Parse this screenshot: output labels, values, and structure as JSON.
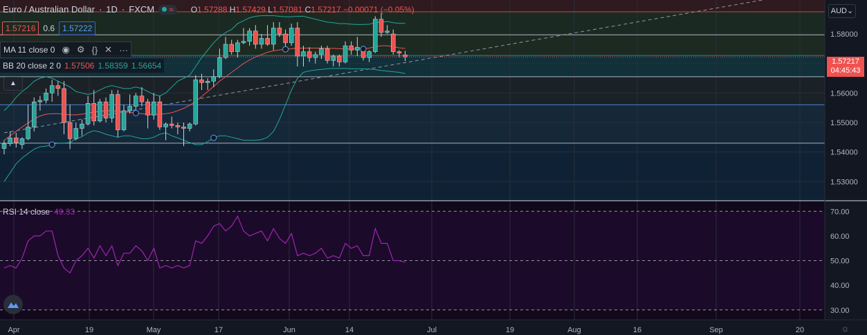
{
  "header": {
    "symbol": "Euro / Australian Dollar",
    "interval": "1D",
    "exchange": "FXCM",
    "open_label": "O",
    "open": "1.57288",
    "high_label": "H",
    "high": "1.57429",
    "low_label": "L",
    "low": "1.57081",
    "close_label": "C",
    "close": "1.57217",
    "change": "−0.00071 (−0.05%)"
  },
  "trade": {
    "sell_price": "1.57216",
    "spread": "0.6",
    "buy_price": "1.57222"
  },
  "indicators": {
    "ma_label": "MA 11 close 0",
    "bb_label": "BB 20 close 2 0",
    "bb_basis": "1.57506",
    "bb_upper": "1.58359",
    "bb_lower": "1.56654",
    "rsi_label": "RSI 14 close",
    "rsi_value": "49.33"
  },
  "currency_button": "AUD",
  "price_tag": {
    "price": "1.57217",
    "countdown": "04:45:43"
  },
  "colors": {
    "up": "#26a69a",
    "down": "#ef5350",
    "rsi": "#9c27b0",
    "bb": "#26a69a",
    "ma": "#ef5350",
    "bg": "#131722"
  },
  "icons": [
    "eye-icon",
    "gear-icon",
    "braces-icon",
    "close-icon",
    "more-icon",
    "chevron-up-icon",
    "tradingview-logo-icon"
  ],
  "chart_data": [
    {
      "type": "candlestick",
      "title": "Euro / Australian Dollar, 1D, FXCM",
      "y_ticks": [
        "1.58000",
        "1.57000",
        "1.56000",
        "1.55000",
        "1.54000",
        "1.53000"
      ],
      "ylim": [
        1.5235,
        1.5915
      ],
      "x_ticks": [
        "Apr",
        "19",
        "May",
        "17",
        "Jun",
        "14",
        "Jul",
        "19",
        "Aug",
        "16",
        "Sep",
        "20"
      ],
      "candles": [
        {
          "o": 1.5412,
          "h": 1.544,
          "l": 1.5392,
          "c": 1.5428
        },
        {
          "o": 1.5428,
          "h": 1.547,
          "l": 1.542,
          "c": 1.5448
        },
        {
          "o": 1.5448,
          "h": 1.5465,
          "l": 1.5415,
          "c": 1.5432
        },
        {
          "o": 1.5425,
          "h": 1.545,
          "l": 1.541,
          "c": 1.5445
        },
        {
          "o": 1.5445,
          "h": 1.556,
          "l": 1.544,
          "c": 1.5485
        },
        {
          "o": 1.5485,
          "h": 1.5585,
          "l": 1.547,
          "c": 1.557
        },
        {
          "o": 1.557,
          "h": 1.559,
          "l": 1.554,
          "c": 1.5575
        },
        {
          "o": 1.5575,
          "h": 1.5615,
          "l": 1.5565,
          "c": 1.56
        },
        {
          "o": 1.56,
          "h": 1.5645,
          "l": 1.557,
          "c": 1.5625
        },
        {
          "o": 1.5625,
          "h": 1.564,
          "l": 1.559,
          "c": 1.5615
        },
        {
          "o": 1.5615,
          "h": 1.564,
          "l": 1.546,
          "c": 1.55
        },
        {
          "o": 1.55,
          "h": 1.556,
          "l": 1.541,
          "c": 1.5445
        },
        {
          "o": 1.5445,
          "h": 1.55,
          "l": 1.544,
          "c": 1.548
        },
        {
          "o": 1.548,
          "h": 1.551,
          "l": 1.5455,
          "c": 1.5495
        },
        {
          "o": 1.5495,
          "h": 1.559,
          "l": 1.549,
          "c": 1.5565
        },
        {
          "o": 1.5565,
          "h": 1.561,
          "l": 1.549,
          "c": 1.5505
        },
        {
          "o": 1.5505,
          "h": 1.558,
          "l": 1.55,
          "c": 1.557
        },
        {
          "o": 1.557,
          "h": 1.5585,
          "l": 1.55,
          "c": 1.5515
        },
        {
          "o": 1.5515,
          "h": 1.561,
          "l": 1.55,
          "c": 1.5595
        },
        {
          "o": 1.5595,
          "h": 1.561,
          "l": 1.545,
          "c": 1.5475
        },
        {
          "o": 1.5475,
          "h": 1.556,
          "l": 1.547,
          "c": 1.554
        },
        {
          "o": 1.554,
          "h": 1.5595,
          "l": 1.553,
          "c": 1.5555
        },
        {
          "o": 1.5555,
          "h": 1.56,
          "l": 1.5545,
          "c": 1.559
        },
        {
          "o": 1.559,
          "h": 1.562,
          "l": 1.5555,
          "c": 1.557
        },
        {
          "o": 1.557,
          "h": 1.558,
          "l": 1.548,
          "c": 1.5525
        },
        {
          "o": 1.5525,
          "h": 1.56,
          "l": 1.551,
          "c": 1.557
        },
        {
          "o": 1.557,
          "h": 1.559,
          "l": 1.5475,
          "c": 1.5485
        },
        {
          "o": 1.5485,
          "h": 1.55,
          "l": 1.544,
          "c": 1.5495
        },
        {
          "o": 1.5495,
          "h": 1.552,
          "l": 1.548,
          "c": 1.549
        },
        {
          "o": 1.549,
          "h": 1.55,
          "l": 1.546,
          "c": 1.5485
        },
        {
          "o": 1.5485,
          "h": 1.55,
          "l": 1.542,
          "c": 1.548
        },
        {
          "o": 1.548,
          "h": 1.55,
          "l": 1.547,
          "c": 1.5495
        },
        {
          "o": 1.5495,
          "h": 1.566,
          "l": 1.549,
          "c": 1.5645
        },
        {
          "o": 1.5645,
          "h": 1.5665,
          "l": 1.561,
          "c": 1.5635
        },
        {
          "o": 1.5635,
          "h": 1.565,
          "l": 1.561,
          "c": 1.564
        },
        {
          "o": 1.564,
          "h": 1.568,
          "l": 1.562,
          "c": 1.5655
        },
        {
          "o": 1.5655,
          "h": 1.575,
          "l": 1.565,
          "c": 1.572
        },
        {
          "o": 1.572,
          "h": 1.579,
          "l": 1.5715,
          "c": 1.5765
        },
        {
          "o": 1.5765,
          "h": 1.578,
          "l": 1.573,
          "c": 1.574
        },
        {
          "o": 1.574,
          "h": 1.578,
          "l": 1.572,
          "c": 1.577
        },
        {
          "o": 1.577,
          "h": 1.582,
          "l": 1.5765,
          "c": 1.5775
        },
        {
          "o": 1.5775,
          "h": 1.582,
          "l": 1.576,
          "c": 1.581
        },
        {
          "o": 1.581,
          "h": 1.583,
          "l": 1.575,
          "c": 1.5765
        },
        {
          "o": 1.5765,
          "h": 1.58,
          "l": 1.575,
          "c": 1.5785
        },
        {
          "o": 1.5785,
          "h": 1.583,
          "l": 1.576,
          "c": 1.5765
        },
        {
          "o": 1.5765,
          "h": 1.584,
          "l": 1.5745,
          "c": 1.582
        },
        {
          "o": 1.582,
          "h": 1.584,
          "l": 1.579,
          "c": 1.58
        },
        {
          "o": 1.58,
          "h": 1.5815,
          "l": 1.5755,
          "c": 1.577
        },
        {
          "o": 1.577,
          "h": 1.5835,
          "l": 1.576,
          "c": 1.582
        },
        {
          "o": 1.582,
          "h": 1.584,
          "l": 1.569,
          "c": 1.5725
        },
        {
          "o": 1.5725,
          "h": 1.576,
          "l": 1.569,
          "c": 1.574
        },
        {
          "o": 1.574,
          "h": 1.5755,
          "l": 1.5705,
          "c": 1.572
        },
        {
          "o": 1.572,
          "h": 1.574,
          "l": 1.57,
          "c": 1.573
        },
        {
          "o": 1.573,
          "h": 1.576,
          "l": 1.5715,
          "c": 1.575
        },
        {
          "o": 1.575,
          "h": 1.576,
          "l": 1.57,
          "c": 1.571
        },
        {
          "o": 1.571,
          "h": 1.573,
          "l": 1.569,
          "c": 1.5725
        },
        {
          "o": 1.5725,
          "h": 1.573,
          "l": 1.569,
          "c": 1.5705
        },
        {
          "o": 1.5705,
          "h": 1.5775,
          "l": 1.57,
          "c": 1.576
        },
        {
          "o": 1.576,
          "h": 1.5775,
          "l": 1.573,
          "c": 1.5745
        },
        {
          "o": 1.5745,
          "h": 1.579,
          "l": 1.5725,
          "c": 1.5755
        },
        {
          "o": 1.5755,
          "h": 1.576,
          "l": 1.571,
          "c": 1.572
        },
        {
          "o": 1.572,
          "h": 1.5745,
          "l": 1.5705,
          "c": 1.574
        },
        {
          "o": 1.574,
          "h": 1.586,
          "l": 1.5735,
          "c": 1.585
        },
        {
          "o": 1.585,
          "h": 1.587,
          "l": 1.579,
          "c": 1.5805
        },
        {
          "o": 1.5805,
          "h": 1.583,
          "l": 1.58,
          "c": 1.581
        },
        {
          "o": 1.58,
          "h": 1.5815,
          "l": 1.573,
          "c": 1.574
        },
        {
          "o": 1.574,
          "h": 1.5745,
          "l": 1.572,
          "c": 1.5735
        },
        {
          "o": 1.5729,
          "h": 1.5743,
          "l": 1.5708,
          "c": 1.5722
        }
      ],
      "horizontal_levels": [
        1.5875,
        1.5797,
        1.5727,
        1.5655,
        1.556,
        1.543
      ],
      "bollinger": {
        "upper": [
          1.554,
          1.556,
          1.5585,
          1.5605,
          1.562,
          1.564,
          1.565,
          1.5655,
          1.565,
          1.564,
          1.563,
          1.562,
          1.5605,
          1.56,
          1.5595,
          1.56,
          1.561,
          1.562,
          1.5625,
          1.562,
          1.5615,
          1.5615,
          1.562,
          1.5615,
          1.5605,
          1.5595,
          1.559,
          1.56,
          1.562,
          1.564,
          1.565,
          1.566,
          1.569,
          1.572,
          1.5745,
          1.577,
          1.579,
          1.5805,
          1.5815,
          1.5835,
          1.5845,
          1.5855,
          1.586,
          1.5862,
          1.5862,
          1.5862,
          1.586,
          1.5858,
          1.5858,
          1.586,
          1.586,
          1.5855,
          1.585,
          1.5845,
          1.584,
          1.5838,
          1.5835,
          1.5835,
          1.5833,
          1.5832,
          1.5832,
          1.5833,
          1.5838,
          1.584,
          1.5842,
          1.5838,
          1.5836,
          1.5836
        ],
        "basis": [
          1.544,
          1.5455,
          1.547,
          1.5485,
          1.5498,
          1.5512,
          1.5522,
          1.5528,
          1.553,
          1.553,
          1.5528,
          1.5526,
          1.5526,
          1.5528,
          1.5532,
          1.5535,
          1.5538,
          1.554,
          1.554,
          1.5538,
          1.5536,
          1.5535,
          1.5532,
          1.553,
          1.5528,
          1.5527,
          1.5528,
          1.553,
          1.5533,
          1.554,
          1.5548,
          1.5558,
          1.5572,
          1.5588,
          1.5605,
          1.5622,
          1.564,
          1.5655,
          1.567,
          1.5685,
          1.57,
          1.5712,
          1.5722,
          1.573,
          1.5738,
          1.5743,
          1.5746,
          1.5748,
          1.575,
          1.5752,
          1.5752,
          1.5752,
          1.5752,
          1.5752,
          1.5751,
          1.5751,
          1.575,
          1.5749,
          1.5749,
          1.5749,
          1.5749,
          1.5752,
          1.5757,
          1.576,
          1.576,
          1.5757,
          1.5753,
          1.5751
        ],
        "lower": [
          1.53,
          1.533,
          1.536,
          1.538,
          1.5395,
          1.541,
          1.5418,
          1.542,
          1.5425,
          1.543,
          1.543,
          1.5432,
          1.5445,
          1.5452,
          1.5465,
          1.5472,
          1.5468,
          1.546,
          1.5455,
          1.545,
          1.5455,
          1.5455,
          1.545,
          1.5445,
          1.5445,
          1.545,
          1.546,
          1.5465,
          1.5455,
          1.5448,
          1.544,
          1.5432,
          1.5425,
          1.5425,
          1.5435,
          1.5448,
          1.5455,
          1.5455,
          1.545,
          1.5445,
          1.544,
          1.544,
          1.544,
          1.5442,
          1.545,
          1.547,
          1.551,
          1.556,
          1.561,
          1.565,
          1.567,
          1.5675,
          1.5678,
          1.568,
          1.5682,
          1.5683,
          1.5683,
          1.5683,
          1.5682,
          1.5682,
          1.5682,
          1.5681,
          1.5679,
          1.5676,
          1.5674,
          1.5672,
          1.567,
          1.5666
        ]
      },
      "rsi": {
        "ylim": [
          26,
          74
        ],
        "ticks": [
          "70.00",
          "60.00",
          "50.00",
          "40.00",
          "30.00"
        ],
        "levels": [
          70,
          50,
          30
        ],
        "values": [
          47,
          48,
          47,
          51,
          58,
          60,
          60,
          62,
          62,
          52,
          47,
          45,
          50,
          52,
          55,
          51,
          56,
          52,
          56,
          48,
          53,
          53,
          56,
          54,
          50,
          55,
          47,
          48,
          47,
          48,
          47,
          48,
          58,
          57,
          60,
          64,
          65,
          62,
          64,
          68,
          62,
          60,
          61,
          62,
          58,
          63,
          59,
          57,
          61,
          52,
          53,
          52,
          53,
          55,
          51,
          52,
          51,
          57,
          55,
          56,
          52,
          52,
          63,
          57,
          57,
          50,
          50,
          49.33
        ]
      }
    }
  ]
}
